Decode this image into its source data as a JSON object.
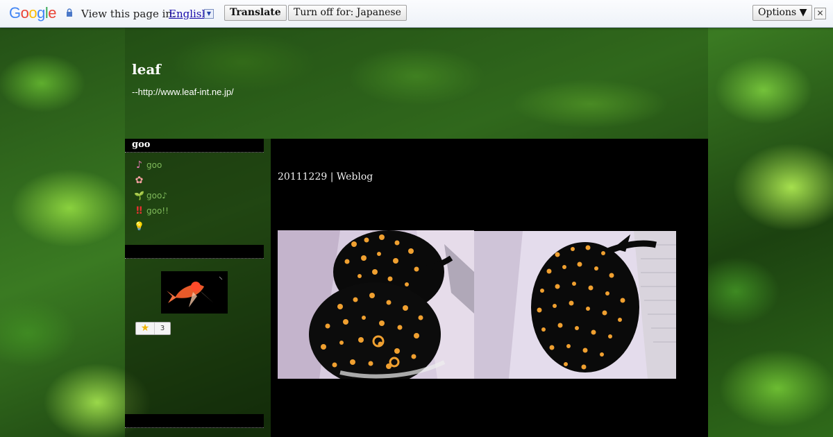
{
  "translate_bar": {
    "logo": "Google",
    "view_text": "View this page in:",
    "language": "English",
    "translate_label": "Translate",
    "turn_off_label": "Turn off for: Japanese",
    "options_label": "Options ▼",
    "close_label": "✕"
  },
  "header": {
    "title": "leaf",
    "subtitle": "--http://www.leaf-int.ne.jp/"
  },
  "sidebar": {
    "section1_title": "goo",
    "items": [
      {
        "icon": "♪",
        "label": "goo"
      },
      {
        "icon": "✿",
        "label": ""
      },
      {
        "icon": "🌱",
        "label": "goo♪"
      },
      {
        "icon": "‼",
        "label": "goo!!"
      },
      {
        "icon": "💡",
        "label": ""
      }
    ],
    "section2_title": "",
    "section3_title": "",
    "star_count": "3"
  },
  "post": {
    "meta": "20111229 | Weblog"
  },
  "colors": {
    "link_green": "#7fb95a",
    "main_bg": "#000000",
    "translate_link": "#1a0dab"
  }
}
